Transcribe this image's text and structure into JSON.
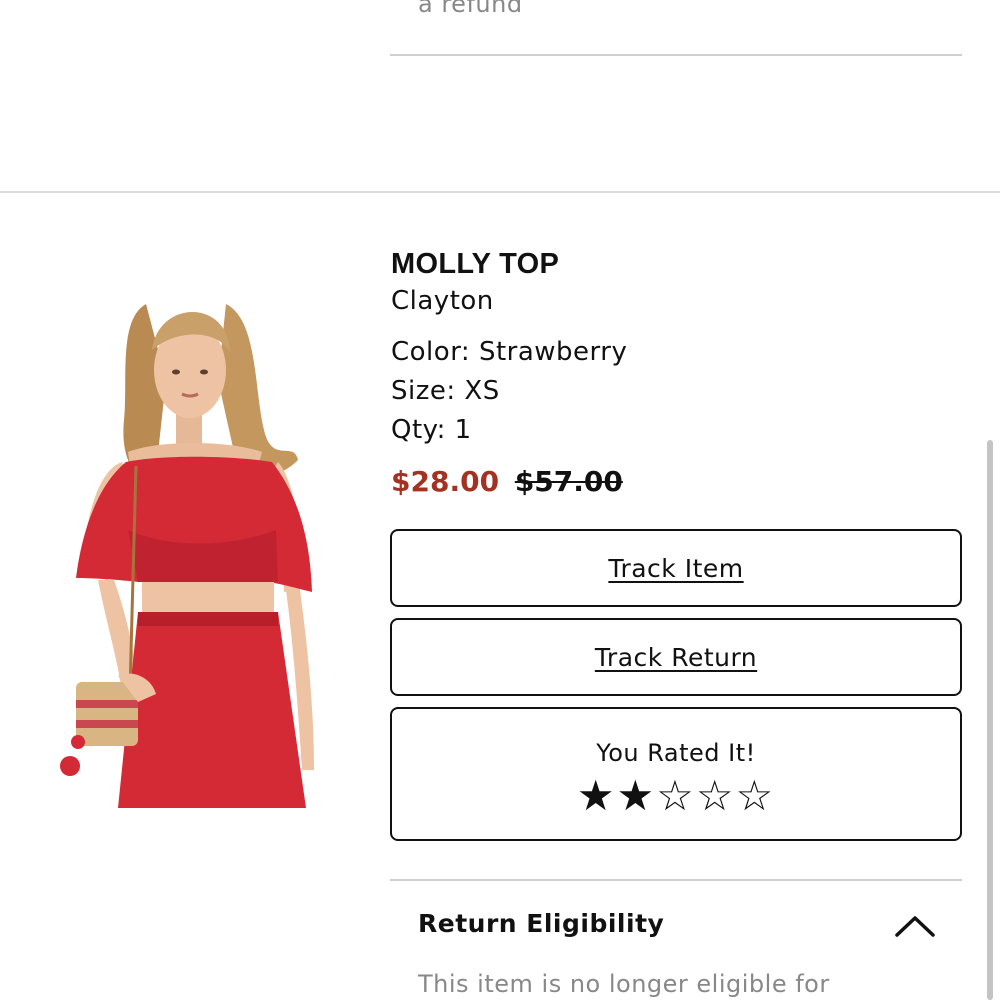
{
  "previous_item": {
    "eligibility_text_tail": "a refund"
  },
  "product": {
    "title": "MOLLY TOP",
    "brand": "Clayton",
    "color_line": "Color: Strawberry",
    "size_line": "Size: XS",
    "qty_line": "Qty: 1",
    "sale_price": "$28.00",
    "original_price": "$57.00",
    "image_alt": "Model wearing red off-shoulder ruffle top with matching red skirt"
  },
  "actions": {
    "track_item_label": "Track Item",
    "track_return_label": "Track Return"
  },
  "rating": {
    "label": "You Rated It!",
    "value": 2,
    "max": 5
  },
  "return_eligibility": {
    "title": "Return Eligibility",
    "text": "This item is no longer eligible for",
    "expanded": true
  },
  "colors": {
    "sale_price": "#a33222",
    "product_red": "#d42a36"
  }
}
